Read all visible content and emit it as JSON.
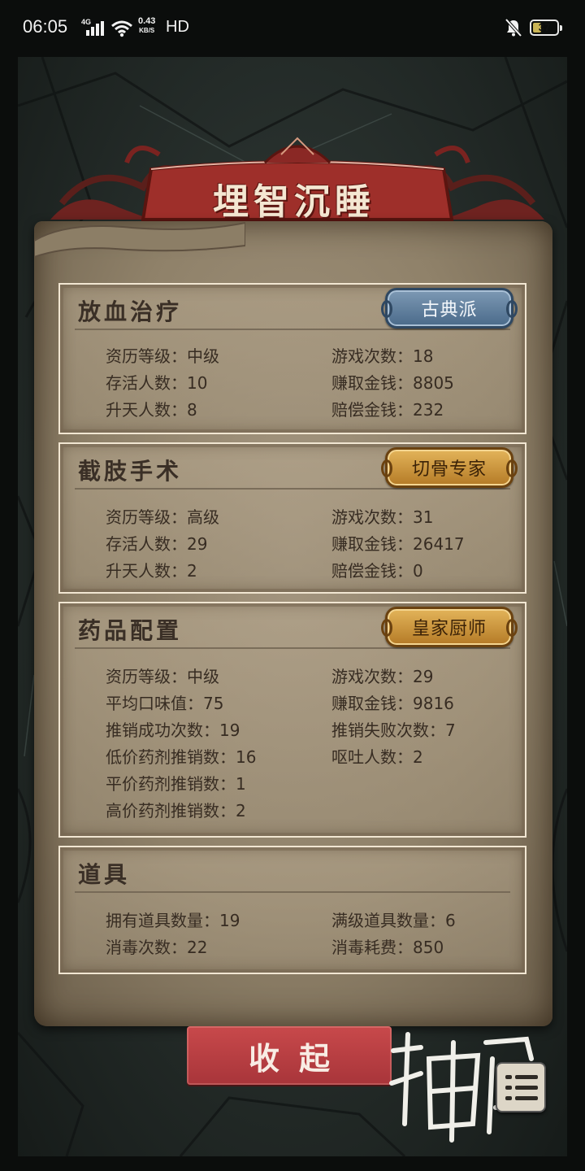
{
  "status_bar": {
    "time": "06:05",
    "network": "4G",
    "speed_value": "0.43",
    "speed_unit": "KB/S",
    "hd": "HD",
    "battery": "37",
    "battery_level": 0.37
  },
  "title": "埋智沉睡",
  "sections": [
    {
      "title": "放血治疗",
      "badge": "古典派",
      "badge_style": "blue",
      "stats_left": [
        "资历等级：中级",
        "存活人数：10",
        "升天人数：8"
      ],
      "stats_right": [
        "游戏次数：18",
        "赚取金钱：8805",
        "赔偿金钱：232"
      ]
    },
    {
      "title": "截肢手术",
      "badge": "切骨专家",
      "badge_style": "gold",
      "stats_left": [
        "资历等级：高级",
        "存活人数：29",
        "升天人数：2"
      ],
      "stats_right": [
        "游戏次数：31",
        "赚取金钱：26417",
        "赔偿金钱：0"
      ]
    },
    {
      "title": "药品配置",
      "badge": "皇家厨师",
      "badge_style": "gold",
      "stats_left": [
        "资历等级：中级",
        "平均口味值：75",
        "推销成功次数：19",
        "低价药剂推销数：16",
        "平价药剂推销数：1",
        "高价药剂推销数：2"
      ],
      "stats_right": [
        "游戏次数：29",
        "赚取金钱：9816",
        "推销失败次数：7",
        "呕吐人数：2"
      ]
    },
    {
      "title": "道具",
      "stats_left": [
        "拥有道具数量：19",
        "消毒次数：22"
      ],
      "stats_right": [
        "满级道具数量：6",
        "消毒耗费：850"
      ]
    }
  ],
  "collapse_button": "收起",
  "colors": {
    "parchment": "#9a8c74",
    "button_red": "#b83e40",
    "badge_blue": "#5f7f9f",
    "badge_gold": "#cd9540",
    "banner_red": "#9e2f2a"
  }
}
